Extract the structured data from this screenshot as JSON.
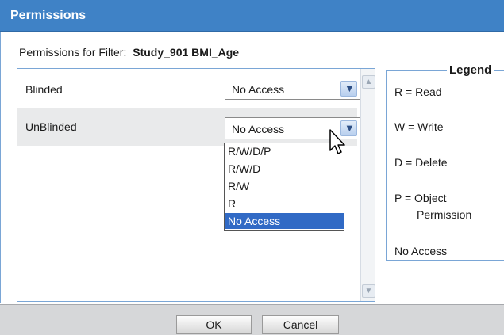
{
  "dialog": {
    "title": "Permissions",
    "filter_label": "Permissions for Filter:",
    "filter_name": "Study_901 BMI_Age"
  },
  "rows": [
    {
      "label": "Blinded",
      "value": "No Access"
    },
    {
      "label": "UnBlinded",
      "value": "No Access"
    }
  ],
  "dropdown": {
    "options": [
      "R/W/D/P",
      "R/W/D",
      "R/W",
      "R",
      "No Access"
    ],
    "selected": "No Access"
  },
  "legend": {
    "title": "Legend",
    "items": [
      "R = Read",
      "W = Write",
      "D = Delete",
      "P = Object",
      "Permission",
      "No Access"
    ]
  },
  "buttons": {
    "ok": "OK",
    "cancel": "Cancel"
  },
  "icons": {
    "combo_arrow": "chevron-down-icon",
    "scroll_up": "scroll-up-icon",
    "scroll_down": "scroll-down-icon",
    "cursor": "mouse-pointer-icon"
  },
  "colors": {
    "title_bar": "#3f82c6",
    "selection": "#316ac5",
    "panel_border": "#7aa6d6"
  }
}
